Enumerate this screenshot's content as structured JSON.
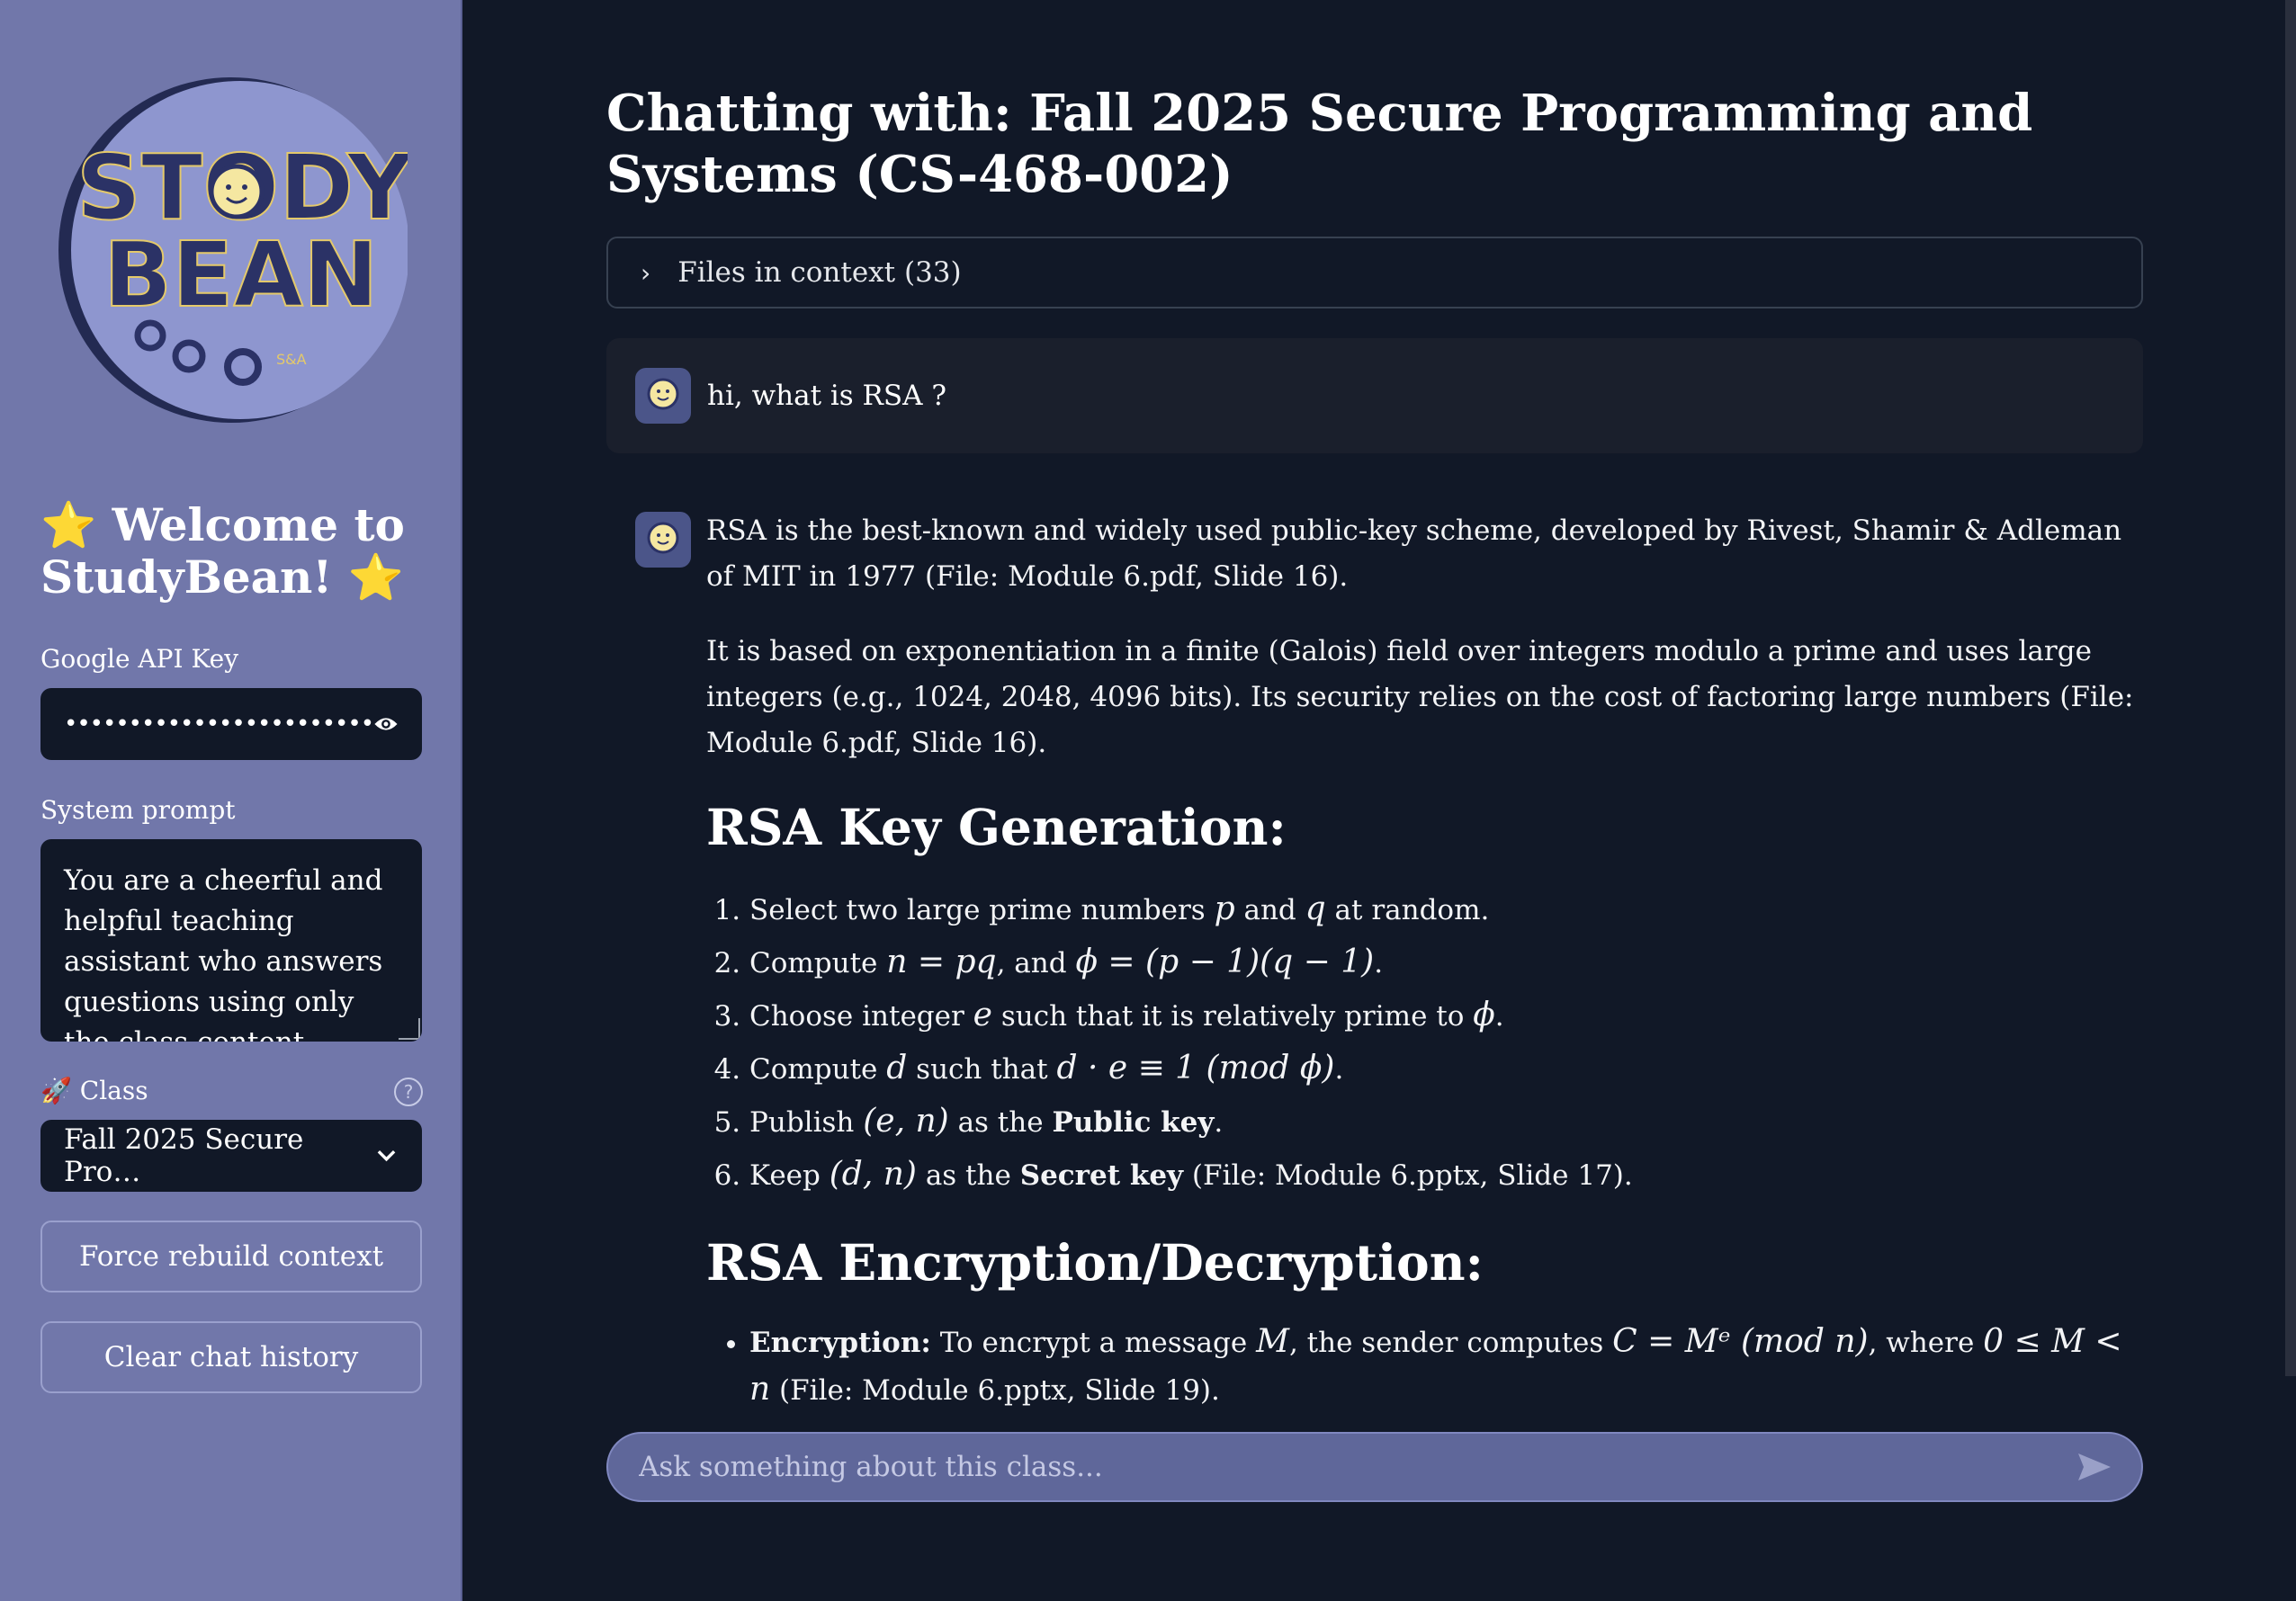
{
  "sidebar": {
    "logo_text_line1": "STODY",
    "logo_text_line2": "BEAN",
    "logo_small": "S&A",
    "welcome_title": "⭐ Welcome to StudyBean! ⭐",
    "api_label": "Google API Key",
    "api_value": "••••••••••••••••••••••••",
    "system_prompt_label": "System prompt",
    "system_prompt_value": "You are a cheerful and helpful teaching assistant who answers questions using only the class content provided to li",
    "class_label": "🚀 Class",
    "class_selected": "Fall 2025 Secure Pro…",
    "rebuild_button": "Force rebuild context",
    "clear_button": "Clear chat history"
  },
  "main": {
    "title": "Chatting with: Fall 2025 Secure Programming and Systems (CS-468-002)",
    "files_in_context": "Files in context (33)",
    "user_message": "hi, what is RSA ?",
    "bot": {
      "p1": "RSA is the best-known and widely used public-key scheme, developed by Rivest, Shamir & Adleman of MIT in 1977 (File: Module 6.pdf, Slide 16).",
      "p2": "It is based on exponentiation in a finite (Galois) field over integers modulo a prime and uses large integers (e.g., 1024, 2048, 4096 bits). Its security relies on the cost of factoring large numbers (File: Module 6.pdf, Slide 16).",
      "h_keygen": "RSA Key Generation:",
      "steps": {
        "s1a": "Select two large prime numbers",
        "s1p": "p",
        "s1and": "and",
        "s1q": "q",
        "s1b": "at random.",
        "s2a": "Compute",
        "s2m1": "n = pq",
        "s2and": ", and",
        "s2m2": "ϕ = (p − 1)(q − 1)",
        "s2end": ".",
        "s3a": "Choose integer",
        "s3e": "e",
        "s3b": "such that it is relatively prime to",
        "s3phi": "ϕ",
        "s3end": ".",
        "s4a": "Compute",
        "s4d": "d",
        "s4b": "such that",
        "s4m": "d · e ≡ 1 (mod ϕ)",
        "s4end": ".",
        "s5a": "Publish",
        "s5m": "(e, n)",
        "s5b": "as the",
        "s5bold": "Public key",
        "s5end": ".",
        "s6a": "Keep",
        "s6m": "(d, n)",
        "s6b": "as the",
        "s6bold": "Secret key",
        "s6c": "(File: Module 6.pptx, Slide 17)."
      },
      "h_encdec": "RSA Encryption/Decryption:",
      "enc": {
        "bold": "Encryption:",
        "a": "To encrypt a message",
        "m": "M",
        "b": ", the sender computes",
        "formula": "C = Mᵉ (mod n)",
        "c": ", where",
        "cond": "0 ≤ M < n",
        "d": "(File: Module 6.pptx, Slide 19)."
      }
    },
    "chat_placeholder": "Ask something about this class..."
  },
  "colors": {
    "sidebar_bg": "#7177aa",
    "main_bg": "#111827",
    "input_bg": "#5f679a"
  }
}
